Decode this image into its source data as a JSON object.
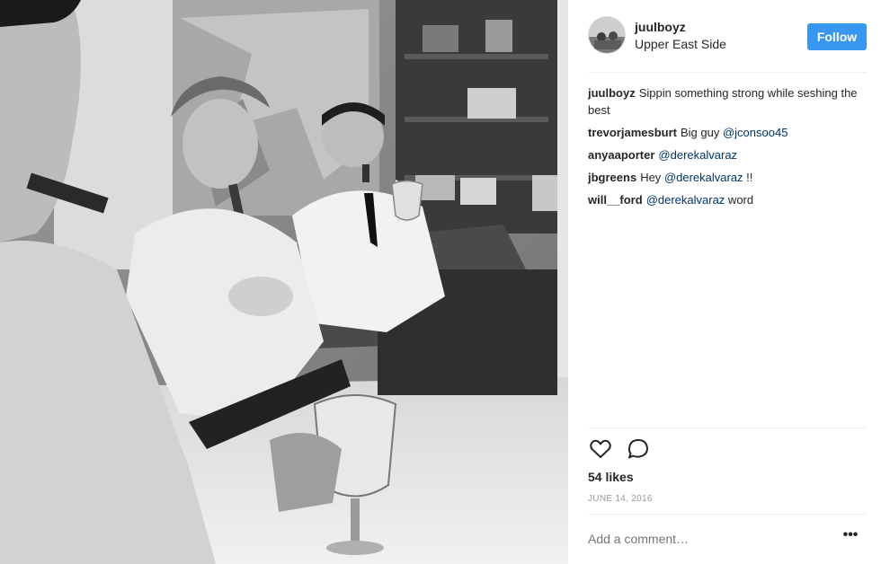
{
  "post": {
    "username": "juulboyz",
    "location": "Upper East Side",
    "follow_label": "Follow",
    "caption": {
      "user": "juulboyz",
      "text": "Sippin something strong while seshing the best"
    },
    "comments": [
      {
        "user": "trevorjamesburt",
        "prefix": "Big guy ",
        "mention": "@jconsoo45",
        "suffix": ""
      },
      {
        "user": "anyaaporter",
        "prefix": "",
        "mention": "@derekalvaraz",
        "suffix": ""
      },
      {
        "user": "jbgreens",
        "prefix": "Hey ",
        "mention": "@derekalvaraz",
        "suffix": " !!"
      },
      {
        "user": "will__ford",
        "prefix": "",
        "mention": "@derekalvaraz",
        "suffix": " word"
      }
    ],
    "likes": "54 likes",
    "date": "JUNE 14, 2016",
    "comment_placeholder": "Add a comment…",
    "more_label": "•••"
  },
  "icons": {
    "like": "heart-icon",
    "comment": "comment-bubble-icon",
    "options": "more-options-icon"
  },
  "colors": {
    "follow_button": "#3897f0",
    "mention": "#003569",
    "text": "#262626",
    "muted": "#999999",
    "divider": "#efefef"
  }
}
